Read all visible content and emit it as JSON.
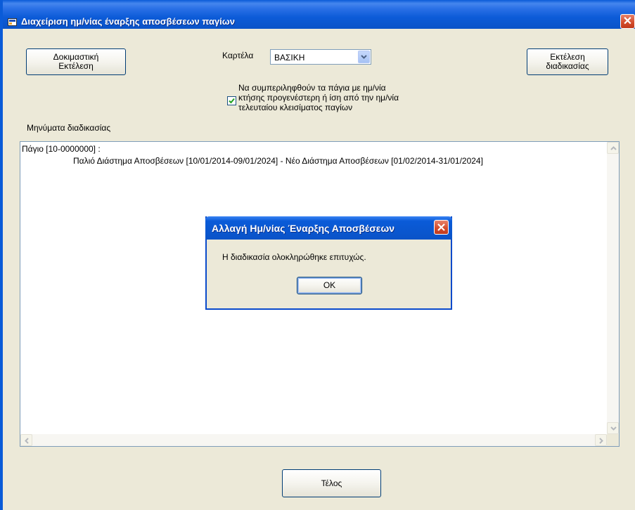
{
  "window": {
    "title": "Διαχείριση ημ/νίας έναρξης αποσβέσεων παγίων",
    "close_symbol": "✕"
  },
  "toolbar": {
    "test_run_label": "Δοκιμαστική\nΕκτέλεση",
    "execute_label": "Εκτέλεση\nδιαδικασίας"
  },
  "tab_select": {
    "label": "Καρτέλα",
    "value": "ΒΑΣΙΚΗ"
  },
  "include_option": {
    "checked": true,
    "label": "Να συμπεριληφθούν τα πάγια με ημ/νία\nκτήσης προγενέστερη ή ίση από την ημ/νία\nτελευταίου κλεισίματος παγίων"
  },
  "messages": {
    "label": "Μηνύματα διαδικασίας",
    "lines": [
      "Πάγιο [10-0000000] :",
      "Παλιό Διάστημα Αποσβέσεων [10/01/2014-09/01/2024] - Νέο Διάστημα Αποσβέσεων [01/02/2014-31/01/2024]"
    ]
  },
  "dialog": {
    "title": "Αλλαγή Ημ/νίας Έναρξης Αποσβέσεων",
    "message": "Η διαδικασία ολοκληρώθηκε επιτυχώς.",
    "ok_label": "OK"
  },
  "footer": {
    "end_label": "Τέλος"
  },
  "colors": {
    "titlebar": "#0A5BD8",
    "face": "#ECE9D8",
    "close": "#D24A2A"
  }
}
